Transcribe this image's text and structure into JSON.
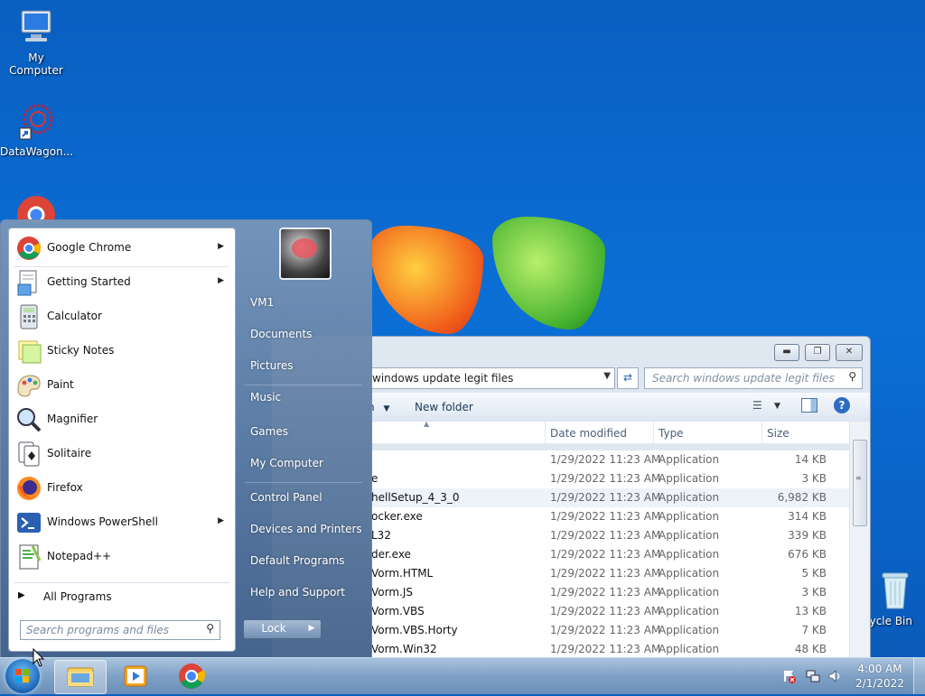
{
  "desktop": {
    "icons": [
      {
        "label": "My Computer"
      },
      {
        "label": "DataWagon..."
      },
      {
        "label": "ycle Bin"
      }
    ]
  },
  "explorer": {
    "address_path": "windows update legit files",
    "search_placeholder": "Search windows update legit files",
    "toolbar": {
      "organize_fragment": "n",
      "new_folder": "New folder"
    },
    "columns": {
      "date": "Date modified",
      "type": "Type",
      "size": "Size"
    },
    "rows": [
      {
        "name": "",
        "date": "1/29/2022 11:23 AM",
        "type": "Application",
        "size": "14 KB"
      },
      {
        "name": "e",
        "date": "1/29/2022 11:23 AM",
        "type": "Application",
        "size": "3 KB"
      },
      {
        "name": "hellSetup_4_3_0",
        "date": "1/29/2022 11:23 AM",
        "type": "Application",
        "size": "6,982 KB"
      },
      {
        "name": "ocker.exe",
        "date": "1/29/2022 11:23 AM",
        "type": "Application",
        "size": "314 KB"
      },
      {
        "name": "L32",
        "date": "1/29/2022 11:23 AM",
        "type": "Application",
        "size": "339 KB"
      },
      {
        "name": "der.exe",
        "date": "1/29/2022 11:23 AM",
        "type": "Application",
        "size": "676 KB"
      },
      {
        "name": "Vorm.HTML",
        "date": "1/29/2022 11:23 AM",
        "type": "Application",
        "size": "5 KB"
      },
      {
        "name": "Vorm.JS",
        "date": "1/29/2022 11:23 AM",
        "type": "Application",
        "size": "3 KB"
      },
      {
        "name": "Vorm.VBS",
        "date": "1/29/2022 11:23 AM",
        "type": "Application",
        "size": "13 KB"
      },
      {
        "name": "Vorm.VBS.Horty",
        "date": "1/29/2022 11:23 AM",
        "type": "Application",
        "size": "7 KB"
      },
      {
        "name": "Vorm.Win32",
        "date": "1/29/2022 11:23 AM",
        "type": "Application",
        "size": "48 KB"
      }
    ]
  },
  "startmenu": {
    "programs": [
      {
        "label": "Google Chrome",
        "submenu": true
      },
      {
        "label": "Getting Started",
        "submenu": true
      },
      {
        "label": "Calculator",
        "submenu": false
      },
      {
        "label": "Sticky Notes",
        "submenu": false
      },
      {
        "label": "Paint",
        "submenu": false
      },
      {
        "label": "Magnifier",
        "submenu": false
      },
      {
        "label": "Solitaire",
        "submenu": false
      },
      {
        "label": "Firefox",
        "submenu": false
      },
      {
        "label": "Windows PowerShell",
        "submenu": true
      },
      {
        "label": "Notepad++",
        "submenu": false
      }
    ],
    "all_programs": "All Programs",
    "search_placeholder": "Search programs and files",
    "right_items": [
      {
        "label": "VM1"
      },
      {
        "label": "Documents"
      },
      {
        "label": "Pictures"
      },
      {
        "label": "Music"
      },
      {
        "label": "Games"
      },
      {
        "label": "My Computer"
      },
      {
        "label": "Control Panel"
      },
      {
        "label": "Devices and Printers"
      },
      {
        "label": "Default Programs"
      },
      {
        "label": "Help and Support"
      }
    ],
    "lock_label": "Lock"
  },
  "taskbar": {
    "time": "4:00 AM",
    "date": "2/1/2022"
  },
  "colors": {
    "accent": "#0b6fd6",
    "taskbar": "#7fa1c6"
  }
}
